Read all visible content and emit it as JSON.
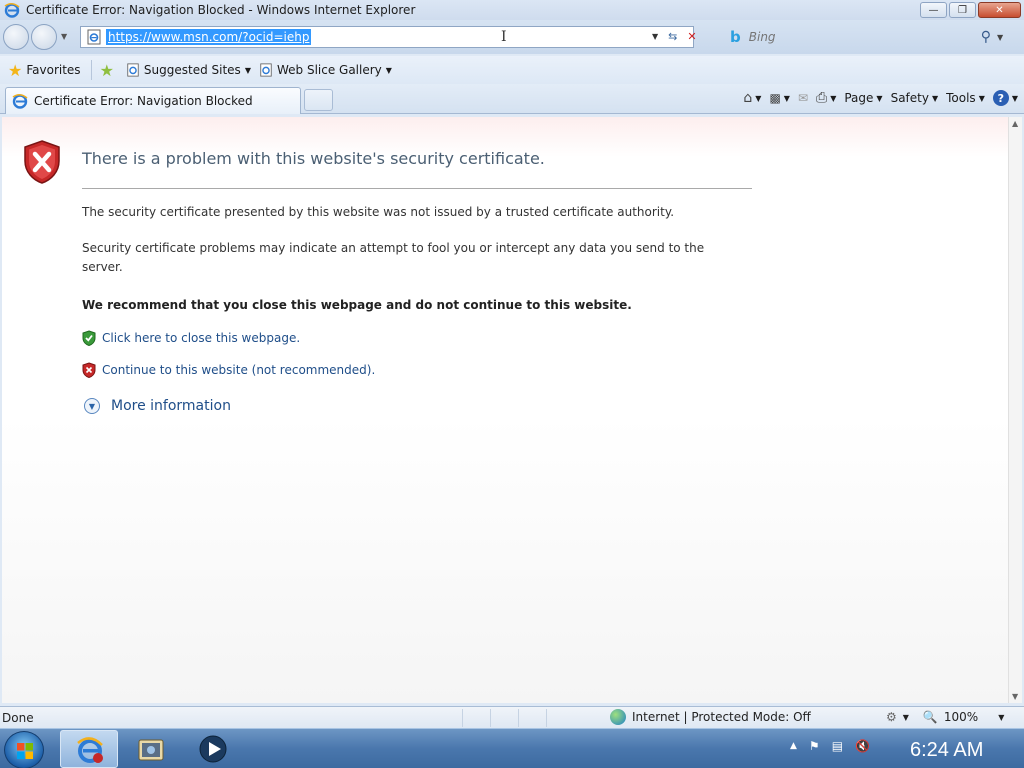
{
  "window": {
    "title": "Certificate Error: Navigation Blocked - Windows Internet Explorer"
  },
  "address_bar": {
    "url": "https://www.msn.com/?ocid=iehp"
  },
  "search": {
    "placeholder": "Bing",
    "engine_icon": "bing-logo"
  },
  "favorites_bar": {
    "favorites_label": "Favorites",
    "suggested_sites_label": "Suggested Sites",
    "web_slice_gallery_label": "Web Slice Gallery"
  },
  "tabs": [
    {
      "label": "Certificate Error: Navigation Blocked",
      "active": true
    }
  ],
  "command_bar": {
    "page_label": "Page",
    "safety_label": "Safety",
    "tools_label": "Tools"
  },
  "content": {
    "title": "There is a problem with this website's security certificate.",
    "paragraph1": "The security certificate presented by this website was not issued by a trusted certificate authority.",
    "paragraph2": "Security certificate problems may indicate an attempt to fool you or intercept any data you send to the server.",
    "recommendation": "We recommend that you close this webpage and do not continue to this website.",
    "close_link": "Click here to close this webpage.",
    "continue_link": "Continue to this website (not recommended).",
    "more_info": "More information"
  },
  "status_bar": {
    "status_text": "Done",
    "zone_text": "Internet | Protected Mode: Off",
    "zoom": "100%"
  },
  "taskbar": {
    "clock": "6:24 AM"
  },
  "colors": {
    "link": "#1f4e89",
    "title_text": "#4b5f73",
    "shield_red": "#c62828",
    "shield_green": "#3a9a3a",
    "url_highlight": "#3399ff"
  }
}
